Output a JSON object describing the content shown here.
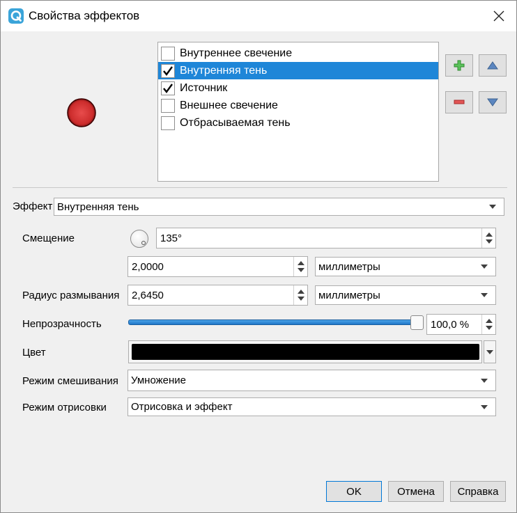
{
  "window": {
    "title": "Свойства эффектов",
    "app_icon": "qgis-logo-icon",
    "close_icon": "close-icon"
  },
  "effects_list": {
    "items": [
      {
        "label": "Внутреннее свечение",
        "checked": false,
        "selected": false
      },
      {
        "label": "Внутренняя тень",
        "checked": true,
        "selected": true
      },
      {
        "label": "Источник",
        "checked": true,
        "selected": false
      },
      {
        "label": "Внешнее свечение",
        "checked": false,
        "selected": false
      },
      {
        "label": "Отбрасываемая тень",
        "checked": false,
        "selected": false
      }
    ]
  },
  "toolbar": {
    "add_icon": "plus-icon",
    "remove_icon": "minus-icon",
    "up_icon": "arrow-up-icon",
    "down_icon": "arrow-down-icon"
  },
  "effect": {
    "label": "Эффект",
    "value": "Внутренняя тень"
  },
  "offset": {
    "label": "Смещение",
    "angle": "135°",
    "distance": "2,0000",
    "units": "миллиметры"
  },
  "blur": {
    "label": "Радиус размывания",
    "value": "2,6450",
    "units": "миллиметры"
  },
  "opacity": {
    "label": "Непрозрачность",
    "value": "100,0 %",
    "level": 1.0
  },
  "color": {
    "label": "Цвет",
    "value": "#000000"
  },
  "blend_mode": {
    "label": "Режим смешивания",
    "value": "Умножение"
  },
  "draw_mode": {
    "label": "Режим отрисовки",
    "value": "Отрисовка и эффект"
  },
  "buttons": {
    "ok": "OK",
    "cancel": "Отмена",
    "help": "Справка"
  },
  "colors": {
    "accent": "#1e86d8",
    "preview_red": "#d43a3a"
  }
}
